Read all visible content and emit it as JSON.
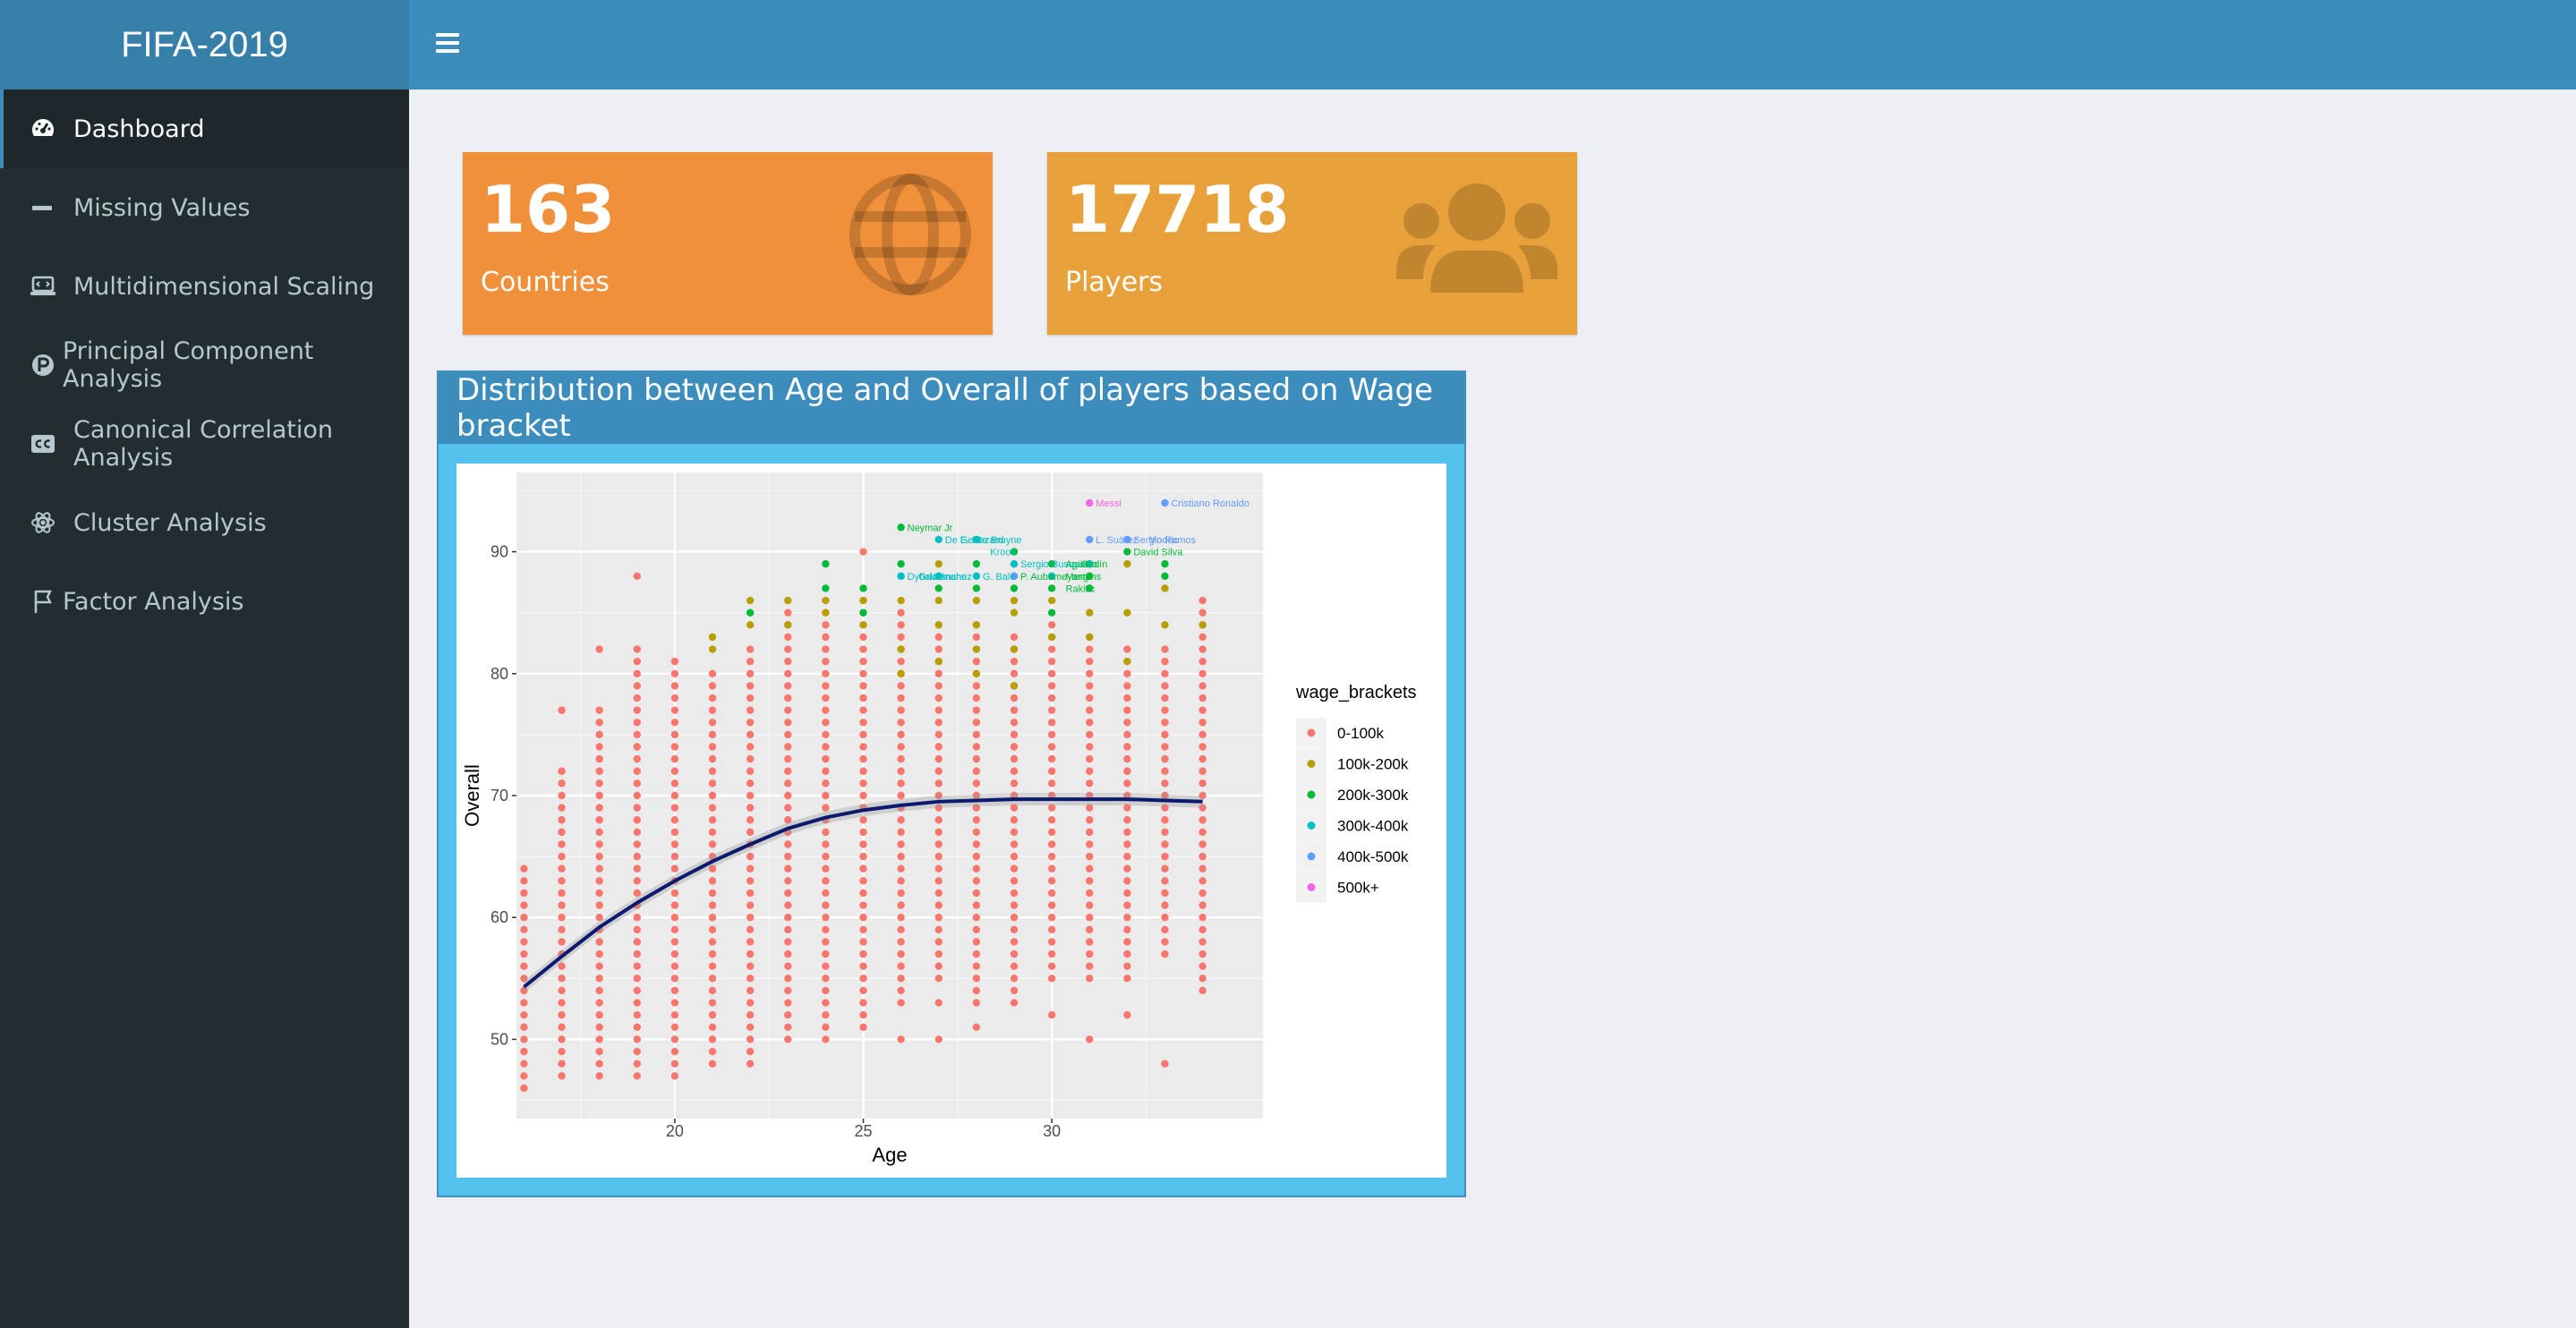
{
  "app_title": "FIFA-2019",
  "sidebar": {
    "items": [
      {
        "label": "Dashboard",
        "icon": "dashboard-icon"
      },
      {
        "label": "Missing Values",
        "icon": "minus-icon"
      },
      {
        "label": "Multidimensional Scaling",
        "icon": "laptop-code-icon"
      },
      {
        "label": "Principal Component Analysis",
        "icon": "product-hunt-icon"
      },
      {
        "label": "Canonical Correlation Analysis",
        "icon": "closed-captioning-icon"
      },
      {
        "label": "Cluster Analysis",
        "icon": "atom-icon"
      },
      {
        "label": "Factor Analysis",
        "icon": "flag-icon"
      }
    ]
  },
  "boxes": {
    "countries": {
      "value": "163",
      "label": "Countries",
      "icon": "globe-icon",
      "color": "#f0903a"
    },
    "players": {
      "value": "17718",
      "label": "Players",
      "icon": "users-icon",
      "color": "#e8a03a"
    }
  },
  "colors": {
    "header": "#3c8dbc",
    "sidebar": "#222d32",
    "panel_border": "#54c0ec"
  },
  "panel_title": "Distribution between Age and Overall of players based on Wage bracket",
  "chart_data": {
    "type": "scatter",
    "xlabel": "Age",
    "ylabel": "Overall",
    "xlim": [
      15.8,
      35.6
    ],
    "ylim": [
      43.5,
      96.5
    ],
    "xticks": [
      20,
      25,
      30
    ],
    "yticks": [
      50,
      60,
      70,
      80,
      90
    ],
    "grid": true,
    "legend": {
      "title": "wage_brackets",
      "position": "right"
    },
    "series": [
      {
        "name": "0-100k",
        "color": "#f8766d",
        "columns": [
          {
            "x": 16,
            "min": 46,
            "max": 64
          },
          {
            "x": 17,
            "min": 47,
            "max": 72,
            "extra": [
              77
            ]
          },
          {
            "x": 18,
            "min": 47,
            "max": 77,
            "extra": [
              82
            ]
          },
          {
            "x": 19,
            "min": 47,
            "max": 82,
            "extra": [
              88
            ]
          },
          {
            "x": 20,
            "min": 47,
            "max": 81
          },
          {
            "x": 21,
            "min": 48,
            "max": 80
          },
          {
            "x": 22,
            "min": 48,
            "max": 82
          },
          {
            "x": 23,
            "min": 50,
            "max": 85
          },
          {
            "x": 24,
            "min": 50,
            "max": 85
          },
          {
            "x": 25,
            "min": 51,
            "max": 86,
            "extra": [
              90
            ]
          },
          {
            "x": 26,
            "min": 53,
            "max": 85,
            "extra": [
              50
            ]
          },
          {
            "x": 27,
            "min": 55,
            "max": 84,
            "extra": [
              50,
              53
            ]
          },
          {
            "x": 28,
            "min": 53,
            "max": 84,
            "extra": [
              51
            ]
          },
          {
            "x": 29,
            "min": 53,
            "max": 83
          },
          {
            "x": 30,
            "min": 55,
            "max": 84,
            "extra": [
              52
            ]
          },
          {
            "x": 31,
            "min": 55,
            "max": 83,
            "extra": [
              50
            ]
          },
          {
            "x": 32,
            "min": 55,
            "max": 82,
            "extra": [
              52
            ]
          },
          {
            "x": 33,
            "min": 57,
            "max": 82,
            "extra": [
              48
            ]
          },
          {
            "x": 34,
            "min": 54,
            "max": 86
          }
        ]
      },
      {
        "name": "100k-200k",
        "color": "#b79f00",
        "points": [
          [
            21,
            83
          ],
          [
            21,
            82
          ],
          [
            22,
            86
          ],
          [
            22,
            84
          ],
          [
            23,
            86
          ],
          [
            23,
            84
          ],
          [
            24,
            86
          ],
          [
            24,
            85
          ],
          [
            25,
            86
          ],
          [
            25,
            84
          ],
          [
            26,
            86
          ],
          [
            26,
            82
          ],
          [
            26,
            80
          ],
          [
            27,
            89
          ],
          [
            27,
            86
          ],
          [
            27,
            84
          ],
          [
            27,
            81
          ],
          [
            28,
            86
          ],
          [
            28,
            84
          ],
          [
            28,
            82
          ],
          [
            28,
            80
          ],
          [
            29,
            86
          ],
          [
            29,
            85
          ],
          [
            29,
            82
          ],
          [
            29,
            79
          ],
          [
            30,
            86
          ],
          [
            30,
            83
          ],
          [
            31,
            88
          ],
          [
            31,
            85
          ],
          [
            31,
            83
          ],
          [
            32,
            89
          ],
          [
            32,
            85
          ],
          [
            32,
            81
          ],
          [
            33,
            87
          ],
          [
            33,
            84
          ],
          [
            34,
            84
          ]
        ]
      },
      {
        "name": "200k-300k",
        "color": "#00ba38",
        "points": [
          [
            22,
            85
          ],
          [
            24,
            89
          ],
          [
            24,
            87
          ],
          [
            25,
            87
          ],
          [
            25,
            85
          ],
          [
            26,
            92
          ],
          [
            26,
            89
          ],
          [
            27,
            88
          ],
          [
            27,
            87
          ],
          [
            28,
            89
          ],
          [
            28,
            87
          ],
          [
            29,
            90
          ],
          [
            29,
            88
          ],
          [
            29,
            87
          ],
          [
            30,
            89
          ],
          [
            30,
            88
          ],
          [
            30,
            87
          ],
          [
            30,
            85
          ],
          [
            31,
            89
          ],
          [
            31,
            88
          ],
          [
            31,
            87
          ],
          [
            32,
            90
          ],
          [
            33,
            89
          ],
          [
            33,
            88
          ]
        ]
      },
      {
        "name": "300k-400k",
        "color": "#00bfc4",
        "points": [
          [
            26,
            88
          ],
          [
            26,
            88
          ],
          [
            27,
            91
          ],
          [
            27,
            88
          ],
          [
            28,
            91
          ],
          [
            28,
            88
          ],
          [
            29,
            89
          ],
          [
            30,
            88
          ],
          [
            31,
            89
          ]
        ]
      },
      {
        "name": "400k-500k",
        "color": "#619cff",
        "points": [
          [
            29,
            88
          ],
          [
            31,
            91
          ],
          [
            32,
            91
          ],
          [
            33,
            94
          ]
        ]
      },
      {
        "name": "500k+",
        "color": "#f564e3",
        "points": [
          [
            31,
            94
          ]
        ]
      }
    ],
    "trend": {
      "color": "#0b1a6e",
      "points": [
        [
          16,
          54.3
        ],
        [
          17,
          56.8
        ],
        [
          18,
          59.2
        ],
        [
          19,
          61.2
        ],
        [
          20,
          63.0
        ],
        [
          21,
          64.6
        ],
        [
          22,
          66.0
        ],
        [
          23,
          67.3
        ],
        [
          24,
          68.2
        ],
        [
          25,
          68.8
        ],
        [
          26,
          69.2
        ],
        [
          27,
          69.5
        ],
        [
          28,
          69.6
        ],
        [
          29,
          69.7
        ],
        [
          30,
          69.7
        ],
        [
          31,
          69.7
        ],
        [
          32,
          69.7
        ],
        [
          33,
          69.6
        ],
        [
          34,
          69.5
        ]
      ]
    },
    "annotations": [
      {
        "text": "Messi",
        "x": 31,
        "y": 94,
        "color": "#f564e3"
      },
      {
        "text": "Cristiano Ronaldo",
        "x": 33,
        "y": 94,
        "color": "#619cff"
      },
      {
        "text": "Neymar Jr",
        "x": 26,
        "y": 92,
        "color": "#00ba38"
      },
      {
        "text": "De Gea",
        "x": 27,
        "y": 91,
        "color": "#00bfc4"
      },
      {
        "text": "E. Hazard",
        "x": 27.4,
        "y": 91,
        "color": "#00bfc4"
      },
      {
        "text": "De Bruyne",
        "x": 27.8,
        "y": 91,
        "color": "#00bfc4"
      },
      {
        "text": "L. Suárez",
        "x": 31,
        "y": 91,
        "color": "#619cff"
      },
      {
        "text": "Sergio Ramos",
        "x": 32,
        "y": 91,
        "color": "#619cff"
      },
      {
        "text": "Modric",
        "x": 32.4,
        "y": 91,
        "color": "#619cff"
      },
      {
        "text": "David Silva",
        "x": 32,
        "y": 90,
        "color": "#00ba38"
      },
      {
        "text": "Kroos",
        "x": 28.2,
        "y": 90,
        "color": "#00bfc4"
      },
      {
        "text": "Sergio Busquets",
        "x": 29,
        "y": 89,
        "color": "#00bfc4"
      },
      {
        "text": "Agüero",
        "x": 30.2,
        "y": 89,
        "color": "#00ba38"
      },
      {
        "text": "Godín",
        "x": 30.6,
        "y": 89,
        "color": "#00ba38"
      },
      {
        "text": "Dybala",
        "x": 26,
        "y": 88,
        "color": "#00bfc4"
      },
      {
        "text": "Griezmann",
        "x": 26.3,
        "y": 88,
        "color": "#00bfc4"
      },
      {
        "text": "Sánchez",
        "x": 26.7,
        "y": 88,
        "color": "#00bfc4"
      },
      {
        "text": "G. Bale",
        "x": 28,
        "y": 88,
        "color": "#00bfc4"
      },
      {
        "text": "P. Aubameyang",
        "x": 29,
        "y": 88,
        "color": "#00ba38"
      },
      {
        "text": "Mertens",
        "x": 30.2,
        "y": 88,
        "color": "#00ba38"
      },
      {
        "text": "Rakitic",
        "x": 30.2,
        "y": 87,
        "color": "#00ba38"
      }
    ]
  }
}
